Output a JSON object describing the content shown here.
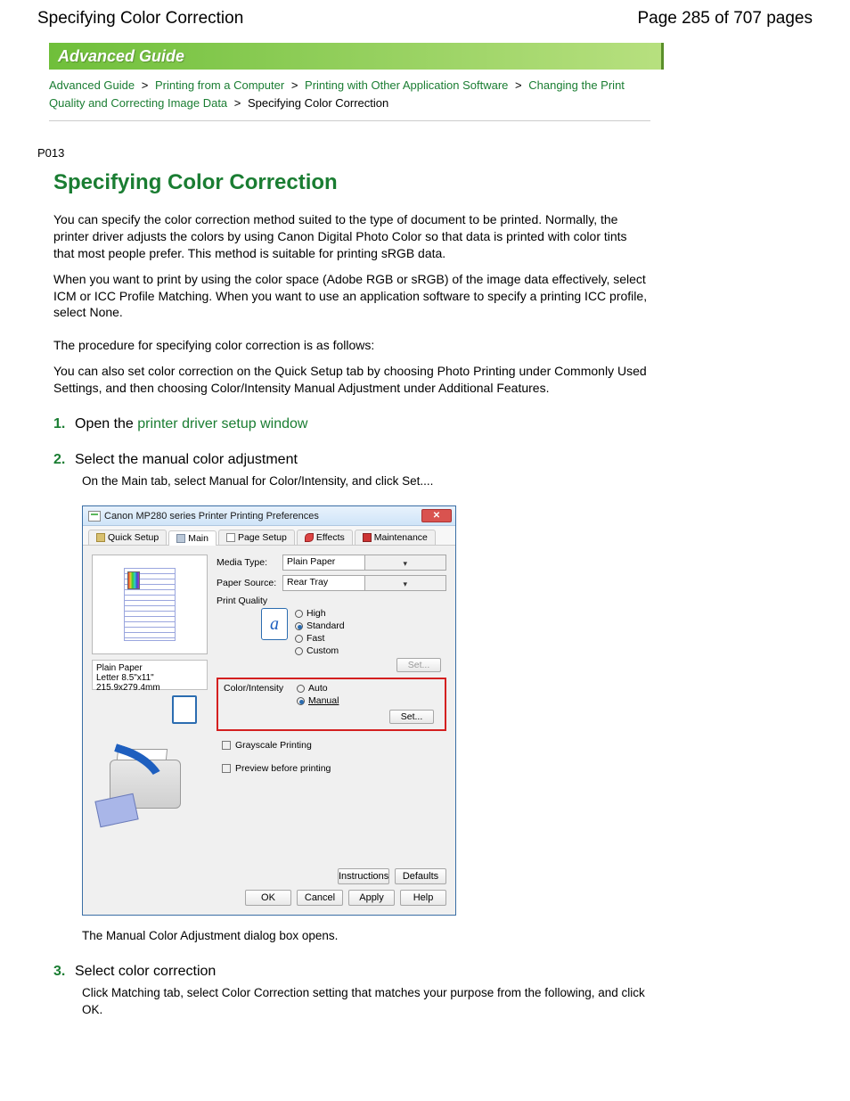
{
  "header": {
    "left": "Specifying Color Correction",
    "right": "Page 285 of 707 pages"
  },
  "banner": "Advanced Guide",
  "breadcrumb": {
    "b1": "Advanced Guide",
    "b2": "Printing from a Computer",
    "b3": "Printing with Other Application Software",
    "b4": "Changing the Print Quality and Correcting Image Data",
    "b5": "Specifying Color Correction",
    "sep": ">"
  },
  "code": "P013",
  "title": "Specifying Color Correction",
  "para1": "You can specify the color correction method suited to the type of document to be printed. Normally, the printer driver adjusts the colors by using Canon Digital Photo Color so that data is printed with color tints that most people prefer. This method is suitable for printing sRGB data.",
  "para2": "When you want to print by using the color space (Adobe RGB or sRGB) of the image data effectively, select ICM or ICC Profile Matching. When you want to use an application software to specify a printing ICC profile, select None.",
  "para3": "The procedure for specifying color correction is as follows:",
  "para4": "You can also set color correction on the Quick Setup tab by choosing Photo Printing under Commonly Used Settings, and then choosing Color/Intensity Manual Adjustment under Additional Features.",
  "steps": {
    "s1": {
      "num": "1.",
      "pre": "Open the ",
      "link": "printer driver setup window"
    },
    "s2": {
      "num": "2.",
      "title": "Select the manual color adjustment",
      "body": "On the Main tab, select Manual for Color/Intensity, and click Set....",
      "closing": "The Manual Color Adjustment dialog box opens."
    },
    "s3": {
      "num": "3.",
      "title": "Select color correction",
      "body": "Click Matching tab, select Color Correction setting that matches your purpose from the following, and click OK."
    }
  },
  "dialog": {
    "title": "Canon MP280 series Printer Printing Preferences",
    "close": "✕",
    "tabs": {
      "t1": "Quick Setup",
      "t2": "Main",
      "t3": "Page Setup",
      "t4": "Effects",
      "t5": "Maintenance"
    },
    "paperinfo": {
      "l1": "Plain Paper",
      "l2": "Letter 8.5\"x11\" 215.9x279.4mm"
    },
    "media": {
      "label": "Media Type:",
      "value": "Plain Paper"
    },
    "source": {
      "label": "Paper Source:",
      "value": "Rear Tray"
    },
    "quality": {
      "label": "Print Quality",
      "opts": {
        "high": "High",
        "standard": "Standard",
        "fast": "Fast",
        "custom": "Custom"
      },
      "set": "Set..."
    },
    "ci": {
      "label": "Color/Intensity",
      "opts": {
        "auto": "Auto",
        "manual": "Manual"
      },
      "set": "Set..."
    },
    "grayscale": "Grayscale Printing",
    "preview": "Preview before printing",
    "footer": {
      "instructions": "Instructions",
      "defaults": "Defaults",
      "ok": "OK",
      "cancel": "Cancel",
      "apply": "Apply",
      "help": "Help"
    }
  }
}
